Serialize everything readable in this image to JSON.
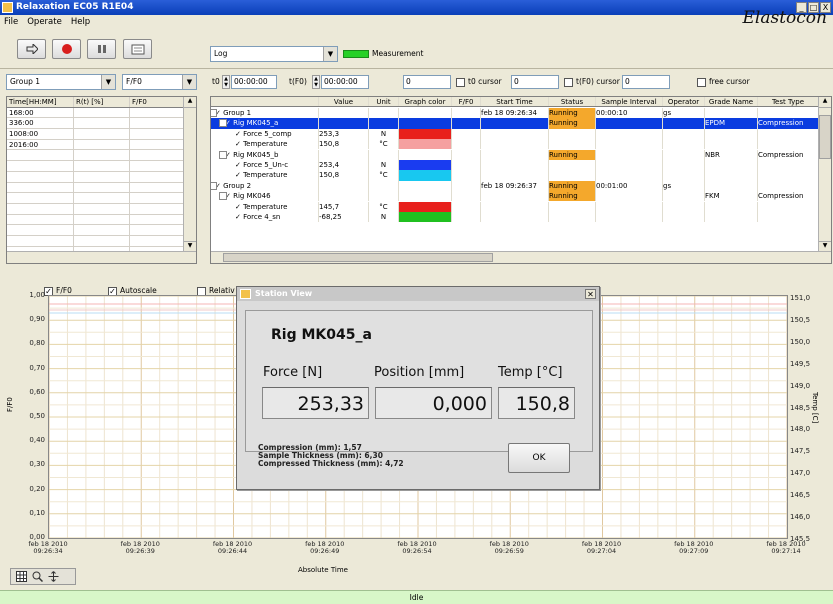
{
  "window": {
    "title": "Relaxation EC05 R1E04",
    "controls": [
      "_",
      "□",
      "X"
    ]
  },
  "menu": [
    "File",
    "Operate",
    "Help"
  ],
  "toolbar": {
    "log_select": "Log",
    "measurement_label": "Measurement",
    "brand": "Elastocon"
  },
  "controls": {
    "group_select": "Group 1",
    "ratio_select": "F/F0",
    "t0_label": "t0",
    "t0_value": "00:00:00",
    "tf0_label": "t(F0)",
    "tf0_value": "00:00:00",
    "field1": "0",
    "t0_cursor_label": "t0 cursor",
    "t0_cursor_value": "0",
    "tf0_cursor_label": "t(F0) cursor",
    "tf0_cursor_value": "0",
    "free_cursor_label": "free cursor"
  },
  "left_table": {
    "headers": [
      "Time[HH:MM]",
      "R(t) [%]",
      "F/F0"
    ],
    "rows": [
      [
        "168:00",
        "",
        ""
      ],
      [
        "336:00",
        "",
        ""
      ],
      [
        "1008:00",
        "",
        ""
      ],
      [
        "2016:00",
        "",
        ""
      ],
      [
        "",
        "",
        ""
      ],
      [
        "",
        "",
        ""
      ],
      [
        "",
        "",
        ""
      ],
      [
        "",
        "",
        ""
      ],
      [
        "",
        "",
        ""
      ],
      [
        "",
        "",
        ""
      ],
      [
        "",
        "",
        ""
      ],
      [
        "",
        "",
        ""
      ],
      [
        "",
        "",
        ""
      ],
      [
        "",
        "",
        ""
      ]
    ]
  },
  "tree_table": {
    "headers": [
      "",
      "Value",
      "Unit",
      "Graph color",
      "F/F0",
      "Start Time",
      "Status",
      "Sample Interval",
      "Operator",
      "Grade Name",
      "Test Type"
    ],
    "rows": [
      {
        "label": "✓ Group 1",
        "indent": 0,
        "value": "",
        "unit": "",
        "color": "",
        "start": "feb 18 09:26:34",
        "status": "Running",
        "interval": "00:00:10",
        "operator": "gs",
        "grade": "",
        "test": "",
        "selected": false
      },
      {
        "label": "✓ Rig MK045_a",
        "indent": 1,
        "value": "",
        "unit": "",
        "color": "",
        "start": "",
        "status": "Running",
        "interval": "",
        "operator": "",
        "grade": "EPDM",
        "test": "Compression",
        "selected": true
      },
      {
        "label": "✓ Force 5_comp",
        "indent": 2,
        "value": "253,3",
        "unit": "N",
        "color": "#e8201c",
        "start": "",
        "status": "",
        "interval": "",
        "operator": "",
        "grade": "",
        "test": "",
        "selected": false
      },
      {
        "label": "✓ Temperature",
        "indent": 2,
        "value": "150,8",
        "unit": "°C",
        "color": "#f5a0a0",
        "start": "",
        "status": "",
        "interval": "",
        "operator": "",
        "grade": "",
        "test": "",
        "selected": false
      },
      {
        "label": "✓ Rig MK045_b",
        "indent": 1,
        "value": "",
        "unit": "",
        "color": "",
        "start": "",
        "status": "Running",
        "interval": "",
        "operator": "",
        "grade": "NBR",
        "test": "Compression",
        "selected": false
      },
      {
        "label": "✓ Force 5_Un-c",
        "indent": 2,
        "value": "253,4",
        "unit": "N",
        "color": "#1a3cf0",
        "start": "",
        "status": "",
        "interval": "",
        "operator": "",
        "grade": "",
        "test": "",
        "selected": false
      },
      {
        "label": "✓ Temperature",
        "indent": 2,
        "value": "150,8",
        "unit": "°C",
        "color": "#18c8f0",
        "start": "",
        "status": "",
        "interval": "",
        "operator": "",
        "grade": "",
        "test": "",
        "selected": false
      },
      {
        "label": "✓ Group 2",
        "indent": 0,
        "value": "",
        "unit": "",
        "color": "",
        "start": "feb 18 09:26:37",
        "status": "Running",
        "interval": "00:01:00",
        "operator": "gs",
        "grade": "",
        "test": "",
        "selected": false
      },
      {
        "label": "✓ Rig MK046",
        "indent": 1,
        "value": "",
        "unit": "",
        "color": "",
        "start": "",
        "status": "Running",
        "interval": "",
        "operator": "",
        "grade": "FKM",
        "test": "Compression",
        "selected": false
      },
      {
        "label": "✓ Temperature",
        "indent": 2,
        "value": "145,7",
        "unit": "°C",
        "color": "#e8201c",
        "start": "",
        "status": "",
        "interval": "",
        "operator": "",
        "grade": "",
        "test": "",
        "selected": false
      },
      {
        "label": "✓ Force 4_sn",
        "indent": 2,
        "value": "-68,25",
        "unit": "N",
        "color": "#20c020",
        "start": "",
        "status": "",
        "interval": "",
        "operator": "",
        "grade": "",
        "test": "",
        "selected": false
      }
    ]
  },
  "chart_options": {
    "ff0": "F/F0",
    "autoscale": "Autoscale",
    "relative": "Relativ"
  },
  "chart_data": {
    "type": "line",
    "title": "",
    "xlabel": "Absolute Time",
    "ylabel": "F/F0",
    "ylabel_right": "Temp [C]",
    "y_ticks": [
      "1,00",
      "0,90",
      "0,80",
      "0,70",
      "0,60",
      "0,50",
      "0,40",
      "0,30",
      "0,20",
      "0,10",
      "0,00"
    ],
    "y_ticks_right": [
      "151,0",
      "150,5",
      "150,0",
      "149,5",
      "149,0",
      "148,5",
      "148,0",
      "147,5",
      "147,0",
      "146,5",
      "146,0",
      "145,5"
    ],
    "x_ticks": [
      {
        "date": "feb 18 2010",
        "time": "09:26:34"
      },
      {
        "date": "feb 18 2010",
        "time": "09:26:39"
      },
      {
        "date": "feb 18 2010",
        "time": "09:26:44"
      },
      {
        "date": "feb 18 2010",
        "time": "09:26:49"
      },
      {
        "date": "feb 18 2010",
        "time": "09:26:54"
      },
      {
        "date": "feb 18 2010",
        "time": "09:26:59"
      },
      {
        "date": "feb 18 2010",
        "time": "09:27:04"
      },
      {
        "date": "feb 18 2010",
        "time": "09:27:09"
      },
      {
        "date": "feb 18 2010",
        "time": "09:27:14"
      }
    ],
    "ylim": [
      0,
      1.0
    ],
    "ylim_right": [
      145.5,
      151.0
    ],
    "grid": true,
    "series": []
  },
  "dialog": {
    "title": "Station View",
    "rig": "Rig MK045_a",
    "force_label": "Force [N]",
    "position_label": "Position [mm]",
    "temp_label": "Temp [°C]",
    "force_value": "253,33",
    "position_value": "0,000",
    "temp_value": "150,8",
    "compression": "Compression (mm): 1,57",
    "sample_thickness": "Sample Thickness (mm): 6,30",
    "compressed_thickness": "Compressed Thickness (mm): 4,72",
    "ok": "OK"
  },
  "status": "Idle"
}
